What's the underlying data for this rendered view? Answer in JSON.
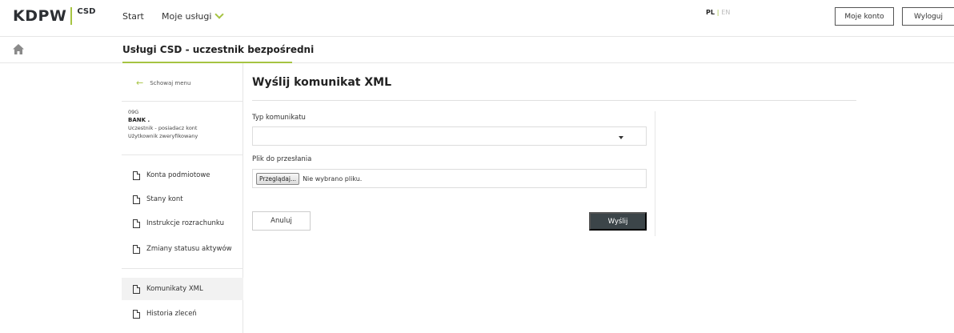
{
  "header": {
    "logo_text": "KDPW",
    "logo_sub": "CSD",
    "nav": {
      "start": "Start",
      "my_services": "Moje usługi"
    },
    "lang": {
      "pl": "PL",
      "sep": "|",
      "en": "EN"
    },
    "my_account": "Moje konto",
    "logout": "Wyloguj"
  },
  "breadcrumb": {
    "title": "Usługi CSD - uczestnik bezpośredni"
  },
  "sidebar": {
    "hide_menu": "Schowaj menu",
    "user": {
      "code": "09G",
      "bank": "BANK  .",
      "role": "Uczestnik - posiadacz kont",
      "status": "Użytkownik zweryfikowany"
    },
    "items": [
      {
        "label": "Konta podmiotowe"
      },
      {
        "label": "Stany kont"
      },
      {
        "label": "Instrukcje rozrachunku"
      },
      {
        "label": "Zmiany statusu aktywów"
      },
      {
        "label": "Komunikaty XML"
      },
      {
        "label": "Historia zleceń"
      }
    ],
    "active_item": "Komunikaty XML"
  },
  "main": {
    "title": "Wyślij komunikat XML",
    "message_type_label": "Typ komunikatu",
    "message_type_value": "",
    "file_label": "Plik do przesłania",
    "browse_button": "Przeglądaj...",
    "file_status": "Nie wybrano pliku.",
    "cancel": "Anuluj",
    "send": "Wyślij"
  },
  "colors": {
    "accent": "#a6c442",
    "dark_button": "#3c4549"
  }
}
